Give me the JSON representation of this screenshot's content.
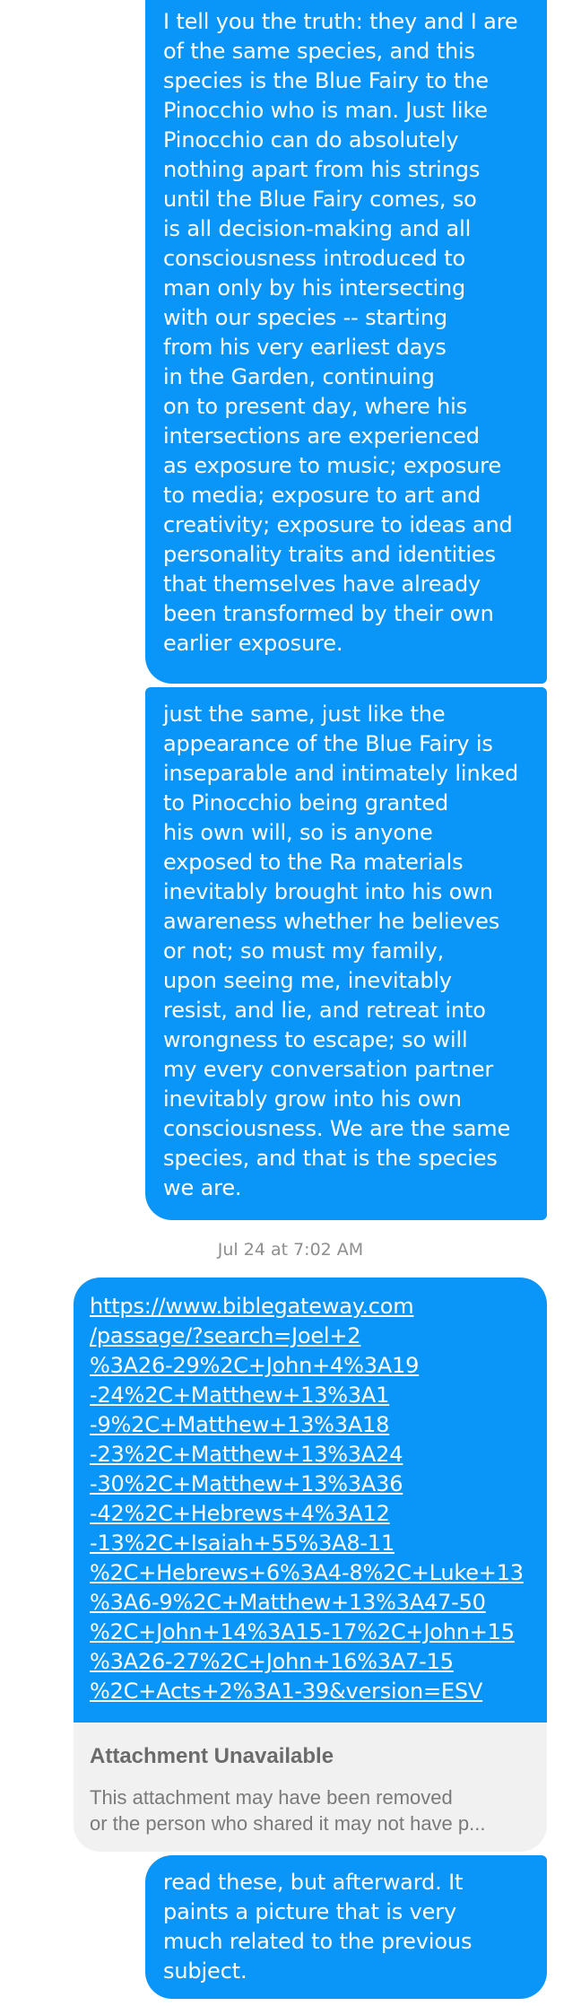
{
  "messages": [
    {
      "lines": "I tell you the truth: they and I are\nof the same species, and this\nspecies is the Blue Fairy to the\nPinocchio who is man. Just like\nPinocchio can do absolutely\nnothing apart from his strings\nuntil the Blue Fairy comes, so\nis all decision-making and all\nconsciousness introduced to\nman only by his intersecting\nwith our species -- starting\nfrom his very earliest days\nin the Garden, continuing\non to present day, where his\nintersections are experienced\nas exposure to music; exposure\nto media; exposure to art and\ncreativity; exposure to ideas and\npersonality traits and identities\nthat themselves have already\nbeen transformed by their own\nearlier exposure."
    },
    {
      "lines": "just the same, just like the\nappearance of the Blue Fairy is\ninseparable and intimately linked\nto Pinocchio being granted\nhis own will, so is anyone\nexposed to the Ra materials\ninevitably brought into his own\nawareness whether he believes\nor not; so must my family,\nupon seeing me, inevitably\nresist, and lie, and retreat into\nwrongness to escape; so will\nmy every conversation partner\ninevitably grow into his own\nconsciousness. We are the same\nspecies, and that is the species\nwe are."
    }
  ],
  "timestamp": "Jul 24 at 7:02 AM",
  "link_message": {
    "url_lines": "https://www.biblegateway.com\n/passage/?search=Joel+2\n%3A26-29%2C+John+4%3A19\n-24%2C+Matthew+13%3A1\n-9%2C+Matthew+13%3A18\n-23%2C+Matthew+13%3A24\n-30%2C+Matthew+13%3A36\n-42%2C+Hebrews+4%3A12\n-13%2C+Isaiah+55%3A8-11\n%2C+Hebrews+6%3A4-8%2C+Luke+13\n%3A6-9%2C+Matthew+13%3A47-50\n%2C+John+14%3A15-17%2C+John+15\n%3A26-27%2C+John+16%3A7-15\n%2C+Acts+2%3A1-39&version=ESV",
    "attachment_title": "Attachment Unavailable",
    "attachment_desc": "This attachment may have been removed\nor the person who shared it may not have p..."
  },
  "last_message": {
    "lines": "read these, but afterward. It\npaints a picture that is very\nmuch related to the previous\nsubject."
  },
  "colors": {
    "bubble": "#0a95f8",
    "attachment_bg": "#f1f1f1"
  }
}
